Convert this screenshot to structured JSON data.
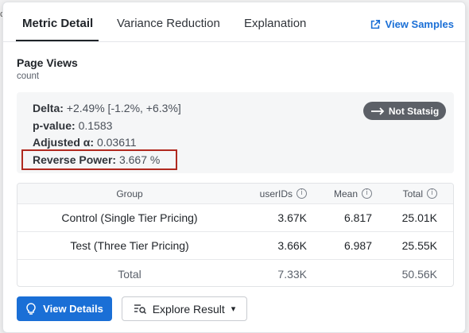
{
  "tabs": [
    {
      "label": "Metric Detail",
      "active": true
    },
    {
      "label": "Variance Reduction",
      "active": false
    },
    {
      "label": "Explanation",
      "active": false
    }
  ],
  "view_samples_label": "View Samples",
  "metric": {
    "title": "Page Views",
    "subtitle": "count"
  },
  "stats": {
    "delta_label": "Delta:",
    "delta_value": "+2.49% [-1.2%, +6.3%]",
    "pvalue_label": "p-value:",
    "pvalue_value": "0.1583",
    "alpha_label": "Adjusted α:",
    "alpha_value": "0.03611",
    "power_label": "Reverse Power:",
    "power_value": "3.667 %"
  },
  "badge": {
    "label": "Not Statsig",
    "icon": "arrow-right-icon"
  },
  "table": {
    "columns": [
      "Group",
      "userIDs",
      "Mean",
      "Total"
    ],
    "rows": [
      {
        "group": "Control (Single Tier Pricing)",
        "users": "3.67K",
        "mean": "6.817",
        "total": "25.01K"
      },
      {
        "group": "Test (Three Tier Pricing)",
        "users": "3.66K",
        "mean": "6.987",
        "total": "25.55K"
      },
      {
        "group": "Total",
        "users": "7.33K",
        "mean": "",
        "total": "50.56K"
      }
    ]
  },
  "buttons": {
    "view_details": "View Details",
    "explore_result": "Explore Result"
  },
  "colors": {
    "accent": "#1a6fd6",
    "highlight": "#b0291f",
    "badge": "#5c6067"
  }
}
